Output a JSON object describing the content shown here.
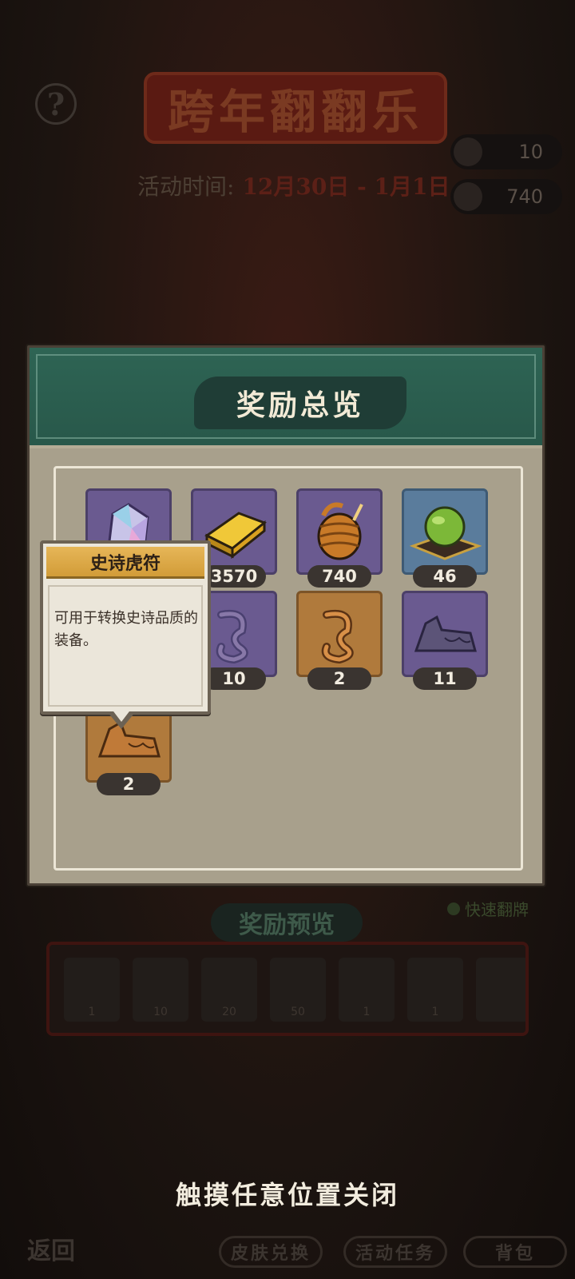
{
  "background": {
    "event_title": "跨年翻翻乐",
    "help_label": "?",
    "time_label": "活动时间:",
    "time_value": "12月30日 - 1月1日",
    "currency_1": "10",
    "currency_2": "740",
    "fast_flip_label": "快速翻牌",
    "preview_title": "奖励预览",
    "preview_items": [
      "1",
      "10",
      "20",
      "50",
      "1",
      "1",
      ""
    ],
    "back_label": "返回",
    "buttons": [
      "皮肤兑换",
      "活动任务",
      "背包"
    ]
  },
  "modal": {
    "title": "奖励总览",
    "rewards": [
      {
        "icon": "crystal-icon",
        "count": "",
        "color": "purple"
      },
      {
        "icon": "gold-ingot-icon",
        "count": "3570",
        "color": "purple"
      },
      {
        "icon": "scroll-coil-icon",
        "count": "740",
        "color": "purple"
      },
      {
        "icon": "jade-orb-icon",
        "count": "46",
        "color": "blue"
      },
      {
        "icon": "dragon-token-icon",
        "count": "",
        "color": "purple"
      },
      {
        "icon": "dragon-token-icon",
        "count": "10",
        "color": "purple"
      },
      {
        "icon": "dragon-token-icon",
        "count": "2",
        "color": "orange"
      },
      {
        "icon": "tiger-token-icon",
        "count": "11",
        "color": "purple"
      },
      {
        "icon": "tiger-token-icon",
        "count": "2",
        "color": "orange"
      }
    ]
  },
  "tooltip": {
    "title": "史诗虎符",
    "description": "可用于转换史诗品质的装备。"
  },
  "close_hint": "触摸任意位置关闭"
}
